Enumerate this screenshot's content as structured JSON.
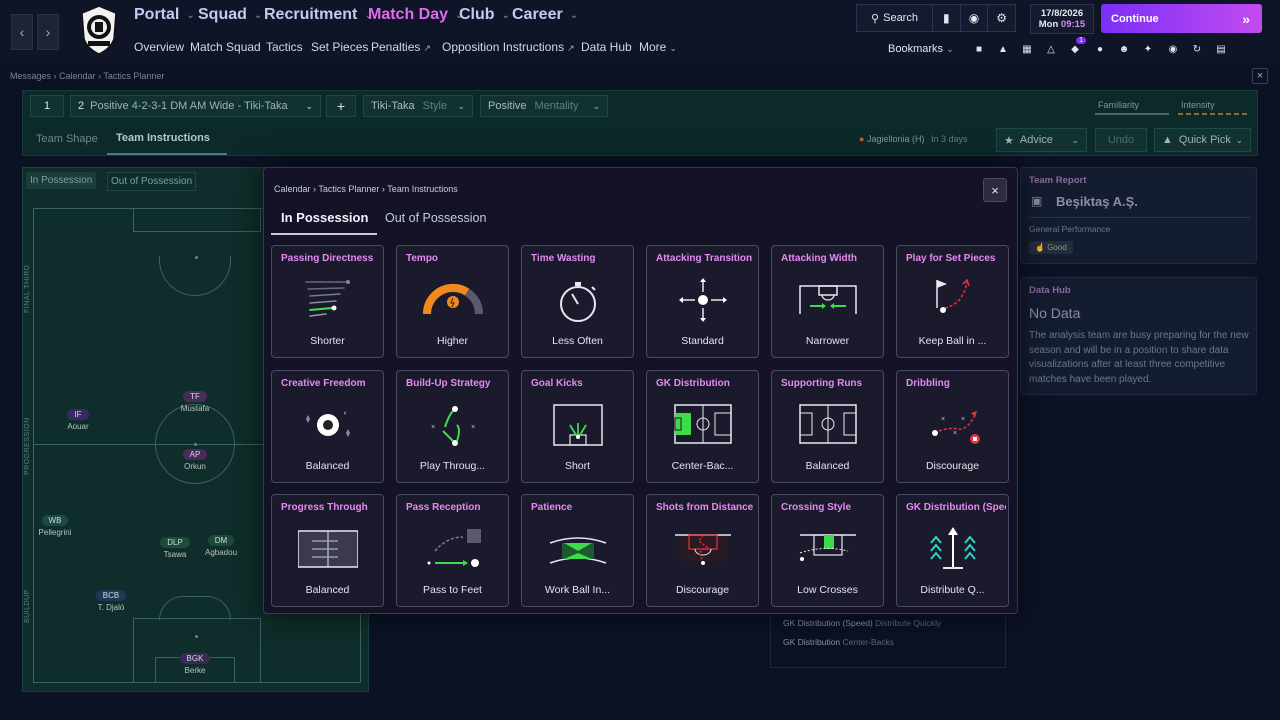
{
  "topnav": {
    "menus": [
      "Portal",
      "Squad",
      "Recruitment",
      "Match Day",
      "Club",
      "Career"
    ],
    "submenu": {
      "overview": "Overview",
      "match_squad": "Match Squad",
      "tactics": "Tactics",
      "set_pieces": "Set Pieces",
      "penalties": "Penalties",
      "opposition": "Opposition Instructions",
      "data_hub": "Data Hub",
      "more": "More"
    },
    "search_label": "Search",
    "date": "17/8/2026",
    "day": "Mon",
    "time": "09:15",
    "continue_label": "Continue",
    "bookmarks_label": "Bookmarks",
    "notification_count": "1"
  },
  "breadcrumb": {
    "items": [
      "Messages",
      "Calendar",
      "Tactics Planner"
    ]
  },
  "tactics": {
    "slot": "1",
    "formation": "Positive 4-2-3-1 DM AM Wide - Tiki-Taka",
    "formation_num": "2",
    "style_value": "Tiki-Taka",
    "style_label": "Style",
    "mentality_value": "Positive",
    "mentality_label": "Mentality",
    "familiarity": "Familiarity",
    "intensity": "Intensity",
    "tabs": [
      "Team Shape",
      "Team Instructions"
    ],
    "next_match": "Jagiellonia (H)",
    "next_match_when": "In 3 days",
    "advice": "Advice",
    "undo": "Undo",
    "quick_pick": "Quick Pick"
  },
  "pitch": {
    "tabs": [
      "In Possession",
      "Out of Possession"
    ],
    "zones": [
      "FINAL THIRD",
      "PROGRESSION",
      "BUILDUP"
    ],
    "players": [
      {
        "role": "IF",
        "name": "Aouar",
        "color": "#3a2a63"
      },
      {
        "role": "TF",
        "name": "Mustafa",
        "color": "#4a2a5a"
      },
      {
        "role": "AP",
        "name": "Orkun",
        "color": "#4a2a5a"
      },
      {
        "role": "WB",
        "name": "Pellegrini",
        "color": "#1c4848"
      },
      {
        "role": "DLP",
        "name": "Tsawa",
        "color": "#1d4a3a"
      },
      {
        "role": "DM",
        "name": "Agbadou",
        "color": "#1d4a3a"
      },
      {
        "role": "BCB",
        "name": "T. Djaló",
        "color": "#1d3a55"
      },
      {
        "role": "BGK",
        "name": "Berke",
        "color": "#3a2a55"
      }
    ]
  },
  "team_report": {
    "title": "Team Report",
    "club": "Beşiktaş A.Ş.",
    "general": "General Performance",
    "rating": "Good"
  },
  "data_hub": {
    "title": "Data Hub",
    "heading": "No Data",
    "text": "The analysis team are busy preparing for the new season and will be in a position to share data visualizations after at least three competitive matches have been played."
  },
  "behind_list": [
    {
      "label": "GK Distribution (Speed)",
      "value": "Distribute Quickly"
    },
    {
      "label": "GK Distribution",
      "value": "Center-Backs"
    }
  ],
  "modal": {
    "breadcrumb": [
      "Calendar",
      "Tactics Planner",
      "Team Instructions"
    ],
    "tabs": [
      "In Possession",
      "Out of Possession"
    ],
    "cards": [
      {
        "title": "Passing Directness",
        "value": "Shorter"
      },
      {
        "title": "Tempo",
        "value": "Higher"
      },
      {
        "title": "Time Wasting",
        "value": "Less Often"
      },
      {
        "title": "Attacking Transition",
        "value": "Standard"
      },
      {
        "title": "Attacking Width",
        "value": "Narrower"
      },
      {
        "title": "Play for Set Pieces",
        "value": "Keep Ball in ..."
      },
      {
        "title": "Creative Freedom",
        "value": "Balanced"
      },
      {
        "title": "Build-Up Strategy",
        "value": "Play Throug..."
      },
      {
        "title": "Goal Kicks",
        "value": "Short"
      },
      {
        "title": "GK Distribution",
        "value": "Center-Bac..."
      },
      {
        "title": "Supporting Runs",
        "value": "Balanced"
      },
      {
        "title": "Dribbling",
        "value": "Discourage"
      },
      {
        "title": "Progress Through",
        "value": "Balanced"
      },
      {
        "title": "Pass Reception",
        "value": "Pass to Feet"
      },
      {
        "title": "Patience",
        "value": "Work Ball In..."
      },
      {
        "title": "Shots from Distance",
        "value": "Discourage"
      },
      {
        "title": "Crossing Style",
        "value": "Low Crosses"
      },
      {
        "title": "GK Distribution (Speed",
        "value": "Distribute Q..."
      }
    ]
  },
  "colors": {
    "accent": "#e06bf0",
    "continue_start": "#7b2ff7",
    "continue_end": "#c14cf0",
    "green": "#3ddc4a",
    "orange": "#f08a1c"
  }
}
